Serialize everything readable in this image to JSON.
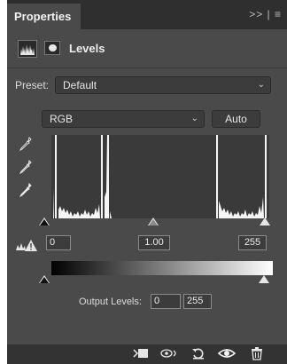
{
  "panel": {
    "tab_title": "Properties",
    "tab_menu": ">> | ≡",
    "header_title": "Levels"
  },
  "preset": {
    "label": "Preset:",
    "value": "Default"
  },
  "channel": {
    "value": "RGB",
    "auto_label": "Auto"
  },
  "input_levels": {
    "black": "0",
    "gamma": "1.00",
    "white": "255"
  },
  "output_levels": {
    "label": "Output Levels:",
    "black": "0",
    "white": "255"
  },
  "icons": {
    "header": [
      "levels-histogram-icon",
      "mask-icon"
    ],
    "eyedroppers": [
      "black-eyedropper-icon",
      "gray-eyedropper-icon",
      "white-eyedropper-icon"
    ],
    "footer": [
      "clip-to-layer-icon",
      "view-previous-state-icon",
      "reset-icon",
      "visibility-eye-icon",
      "trash-icon"
    ]
  },
  "colors": {
    "panel_bg": "#4a4a4a",
    "tabbar_bg": "#2f2f2f",
    "histogram_bg": "#3a3a3a",
    "control_bg": "#3c3c3c"
  }
}
